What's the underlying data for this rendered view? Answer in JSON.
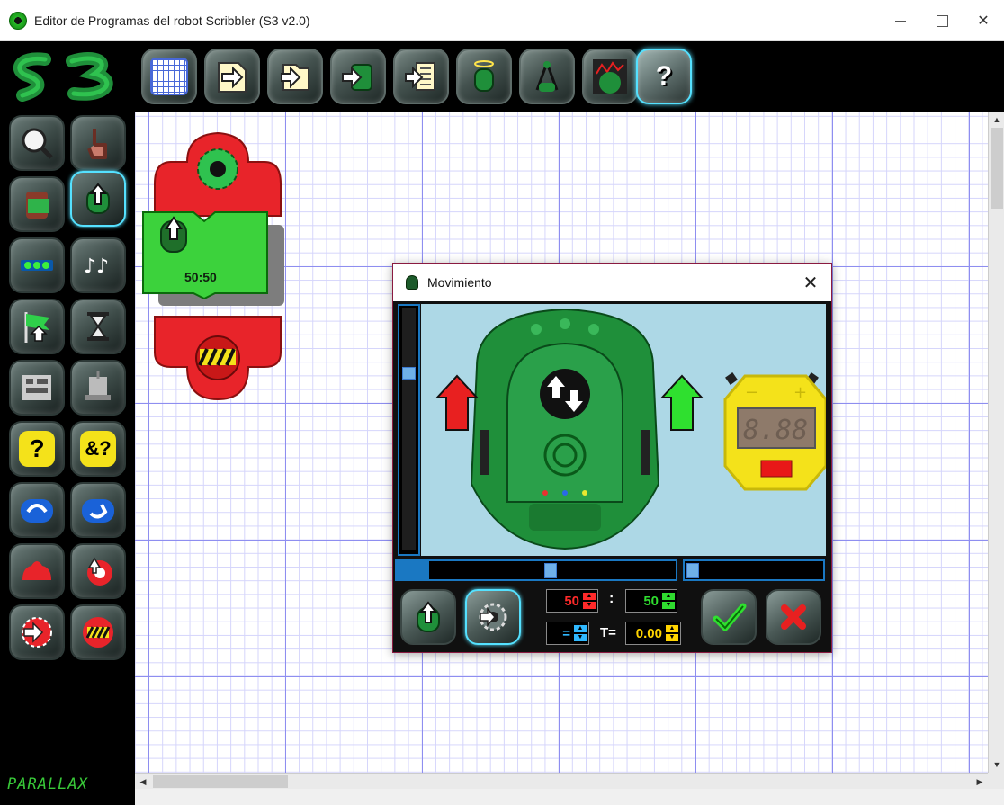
{
  "window": {
    "title": "Editor de Programas del robot Scribbler (S3 v2.0)",
    "min_label": "",
    "max_label": "",
    "close_label": "✕"
  },
  "toolbar": {
    "logo_text": "S3",
    "buttons": [
      {
        "icon": "calendar-grid-icon"
      },
      {
        "icon": "new-file-icon"
      },
      {
        "icon": "open-file-icon"
      },
      {
        "icon": "save-file-icon"
      },
      {
        "icon": "save-as-file-icon"
      },
      {
        "icon": "robot-halo-icon"
      },
      {
        "icon": "robot-compass-icon"
      },
      {
        "icon": "robot-broken-icon"
      },
      {
        "icon": "help-icon"
      }
    ],
    "help_label": "?"
  },
  "palette": {
    "buttons": [
      {
        "icon": "zoom-icon"
      },
      {
        "icon": "hand-pointer-icon"
      },
      {
        "icon": "clipboard-icon"
      },
      {
        "icon": "move-robot-icon"
      },
      {
        "icon": "leds-icon"
      },
      {
        "icon": "music-notes-icon"
      },
      {
        "icon": "flag-start-icon"
      },
      {
        "icon": "hourglass-icon"
      },
      {
        "icon": "sensors-icon"
      },
      {
        "icon": "vise-icon"
      },
      {
        "icon": "if-question-icon"
      },
      {
        "icon": "and-question-icon"
      },
      {
        "icon": "loop-icon"
      },
      {
        "icon": "loop-return-icon"
      },
      {
        "icon": "subroutine-icon"
      },
      {
        "icon": "call-subroutine-icon"
      },
      {
        "icon": "start-gear-icon"
      },
      {
        "icon": "end-stop-icon"
      }
    ],
    "if_label": "?",
    "and_label": "&?",
    "brand": "PARALLAX"
  },
  "program": {
    "move_tile_label": "50:50"
  },
  "dialog": {
    "title": "Movimiento",
    "close_label": "✕",
    "left_speed": "50",
    "right_speed": "50",
    "colon": ":",
    "operator": "=",
    "time_label": "T=",
    "time_value": "0.00",
    "stopwatch_display": "8.88",
    "stopwatch_minus": "−",
    "stopwatch_plus": "+",
    "ok_icon": "checkmark-icon",
    "cancel_icon": "cancel-x-icon"
  },
  "colors": {
    "accent_cyan": "#55e1ff",
    "slider_blue": "#1a78c2",
    "tile_red": "#e8242a",
    "tile_green": "#3cd23c",
    "left_speed_color": "#ff2a2a",
    "right_speed_color": "#2fdc2f",
    "time_color": "#ffd400"
  }
}
